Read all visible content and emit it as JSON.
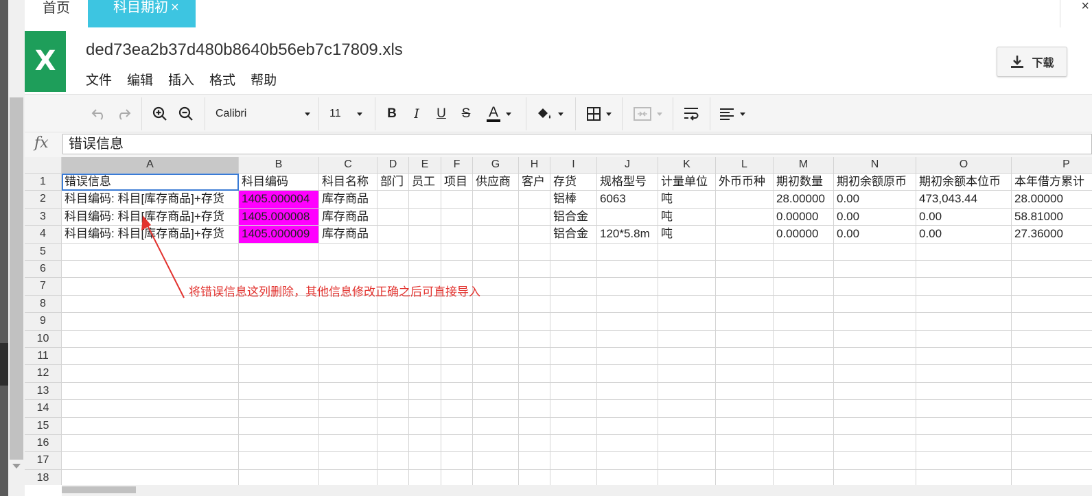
{
  "tabs": {
    "home": "首页",
    "active": "科目期初",
    "active_close": "×",
    "window_close": "×"
  },
  "file": {
    "logo": "X",
    "name": "ded73ea2b37d480b8640b56eb7c17809.xls"
  },
  "menu": [
    "文件",
    "编辑",
    "插入",
    "格式",
    "帮助"
  ],
  "download": {
    "label": "下载"
  },
  "toolbar": {
    "font": "Calibri",
    "size": "11",
    "bold": "B",
    "italic": "I",
    "underline": "U",
    "strike": "S",
    "font_color_letter": "A"
  },
  "formula": {
    "fx": "fx",
    "value": "错误信息"
  },
  "columns": [
    "A",
    "B",
    "C",
    "D",
    "E",
    "F",
    "G",
    "H",
    "I",
    "J",
    "K",
    "L",
    "M",
    "N",
    "O",
    "P"
  ],
  "rows": [
    "1",
    "2",
    "3",
    "4",
    "5",
    "6",
    "7",
    "8",
    "9",
    "10",
    "11",
    "12",
    "13",
    "14",
    "15",
    "16",
    "17",
    "18"
  ],
  "cells": [
    [
      "错误信息",
      "科目编码",
      "科目名称",
      "部门",
      "员工",
      "项目",
      "供应商",
      "客户",
      "存货",
      "规格型号",
      "计量单位",
      "外币币种",
      "期初数量",
      "期初余额原币",
      "期初余额本位币",
      "本年借方累计"
    ],
    [
      "科目编码: 科目[库存商品]+存货",
      "1405.000004",
      "库存商品",
      "",
      "",
      "",
      "",
      "",
      "铝棒",
      "6063",
      "吨",
      "",
      "28.00000",
      "0.00",
      "473,043.44",
      "28.00000"
    ],
    [
      "科目编码: 科目[库存商品]+存货",
      "1405.000008",
      "库存商品",
      "",
      "",
      "",
      "",
      "",
      "铝合金",
      "",
      "吨",
      "",
      "0.00000",
      "0.00",
      "0.00",
      "58.81000"
    ],
    [
      "科目编码: 科目[库存商品]+存货",
      "1405.000009",
      "库存商品",
      "",
      "",
      "",
      "",
      "",
      "铝合金",
      "120*5.8m",
      "吨",
      "",
      "0.00000",
      "0.00",
      "0.00",
      "27.36000"
    ]
  ],
  "annotation": "将错误信息这列删除，其他信息修改正确之后可直接导入",
  "colors": {
    "accent_tab": "#3dc5e1",
    "excel_green": "#1e9e5a",
    "highlight": "#ff00ff",
    "annotation": "#e2322e"
  }
}
